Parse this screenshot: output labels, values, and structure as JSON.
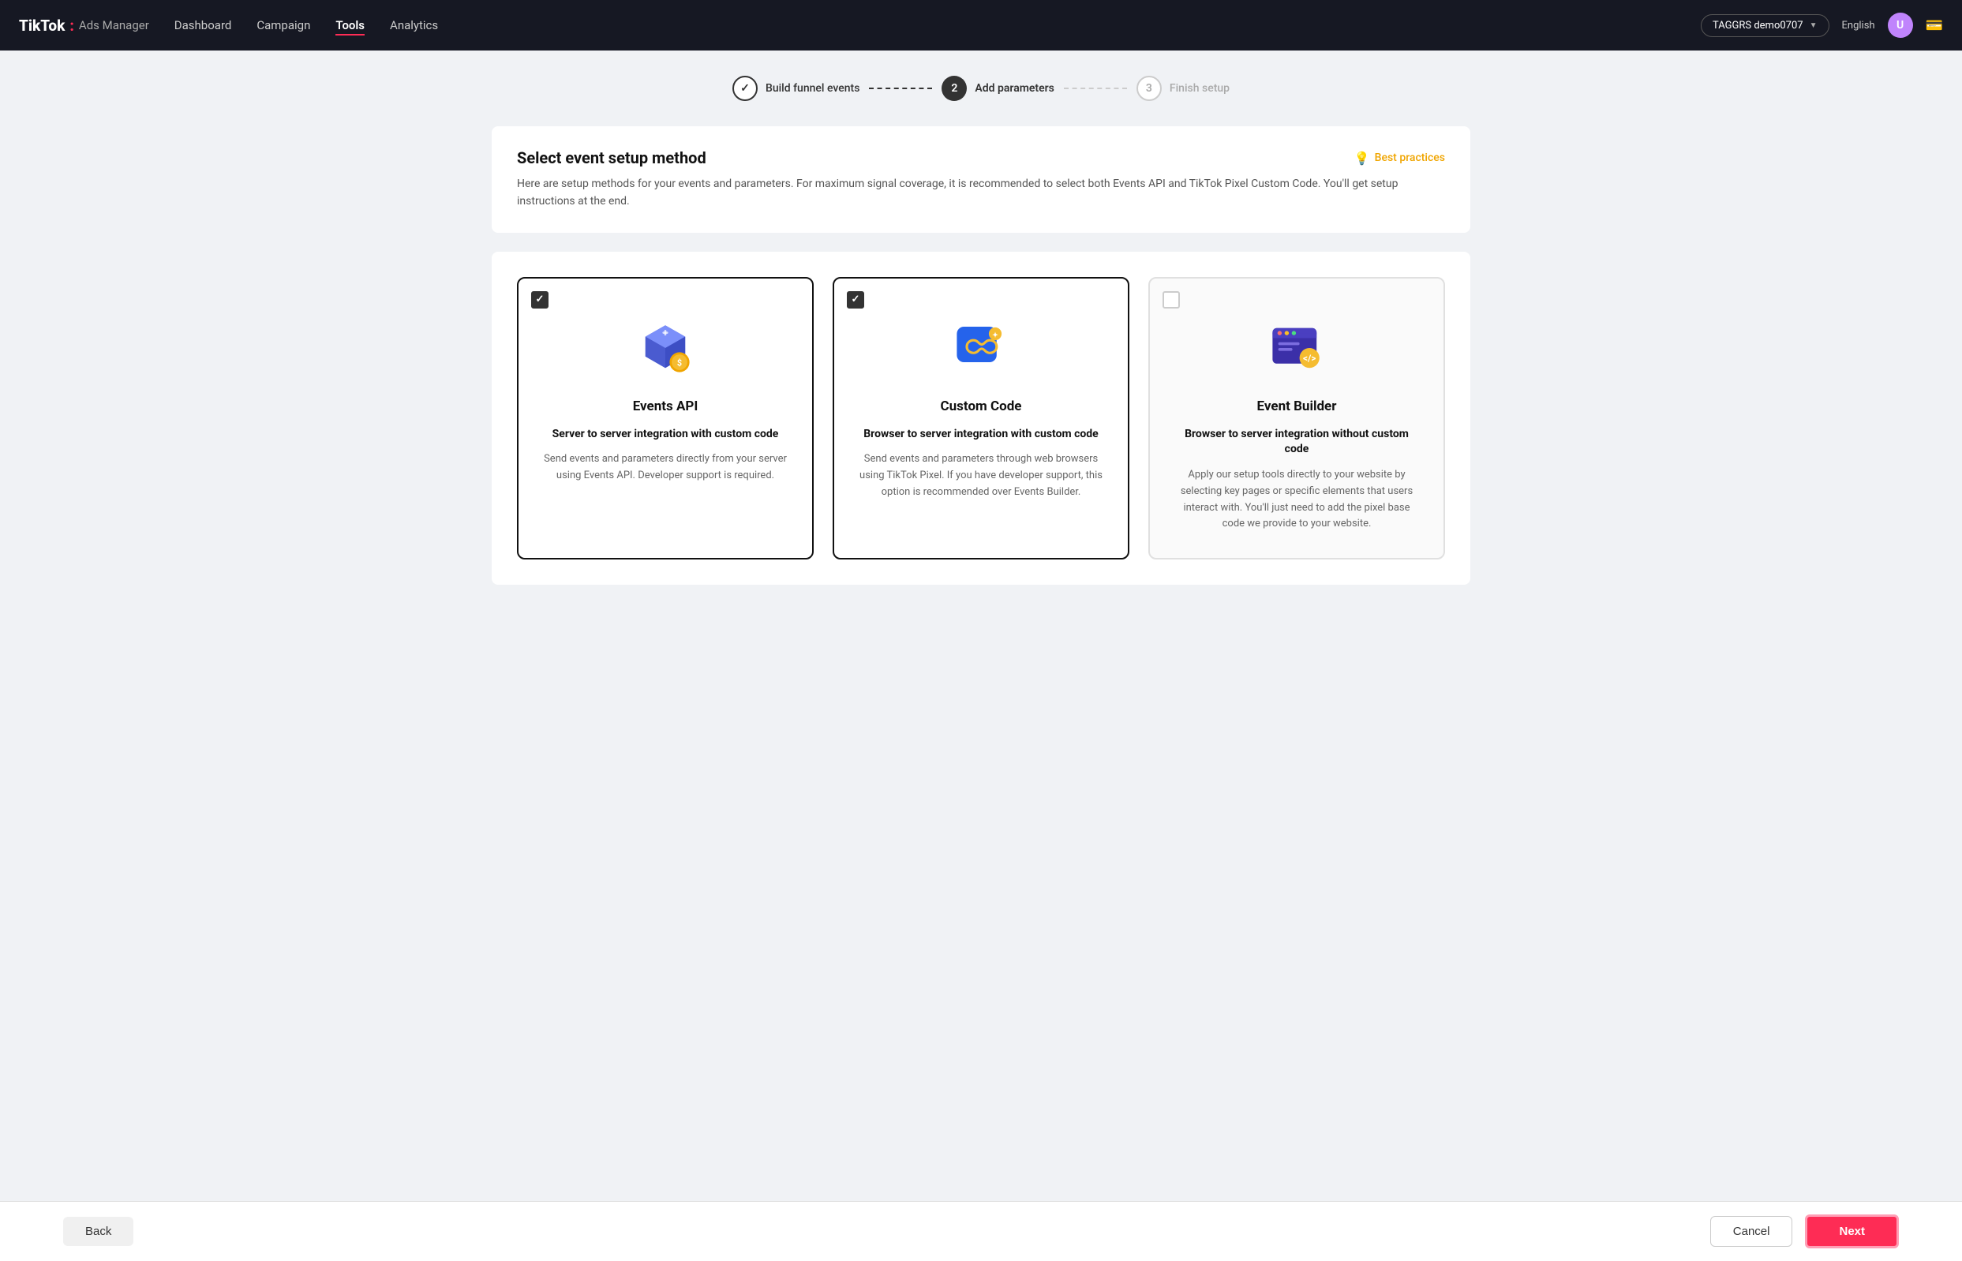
{
  "header": {
    "logo": {
      "brand": "TikTok",
      "separator": ":",
      "product": "Ads Manager"
    },
    "nav": [
      {
        "id": "dashboard",
        "label": "Dashboard",
        "active": false
      },
      {
        "id": "campaign",
        "label": "Campaign",
        "active": false
      },
      {
        "id": "tools",
        "label": "Tools",
        "active": true
      },
      {
        "id": "analytics",
        "label": "Analytics",
        "active": false
      }
    ],
    "account": "TAGGRS demo0707",
    "language": "English",
    "avatar_letter": "U"
  },
  "stepper": {
    "steps": [
      {
        "id": "build-funnel",
        "number": "✓",
        "label": "Build funnel events",
        "state": "completed"
      },
      {
        "id": "add-params",
        "number": "2",
        "label": "Add parameters",
        "state": "active"
      },
      {
        "id": "finish-setup",
        "number": "3",
        "label": "Finish setup",
        "state": "inactive"
      }
    ]
  },
  "select_method": {
    "title": "Select event setup method",
    "description": "Here are setup methods for your events and parameters. For maximum signal coverage, it is recommended to select both Events API and TikTok Pixel Custom Code. You'll get setup instructions at the end.",
    "best_practices_label": "Best practices"
  },
  "cards": [
    {
      "id": "events-api",
      "title": "Events API",
      "subtitle": "Server to server integration with custom code",
      "description": "Send events and parameters directly from your server using Events API. Developer support is required.",
      "checked": true
    },
    {
      "id": "custom-code",
      "title": "Custom Code",
      "subtitle": "Browser to server integration with custom code",
      "description": "Send events and parameters through web browsers using TikTok Pixel. If you have developer support, this option is recommended over Events Builder.",
      "checked": true
    },
    {
      "id": "event-builder",
      "title": "Event Builder",
      "subtitle": "Browser to server integration without custom code",
      "description": "Apply our setup tools directly to your website by selecting key pages or specific elements that users interact with. You'll just need to add the pixel base code we provide to your website.",
      "checked": false
    }
  ],
  "footer": {
    "back_label": "Back",
    "cancel_label": "Cancel",
    "next_label": "Next"
  }
}
